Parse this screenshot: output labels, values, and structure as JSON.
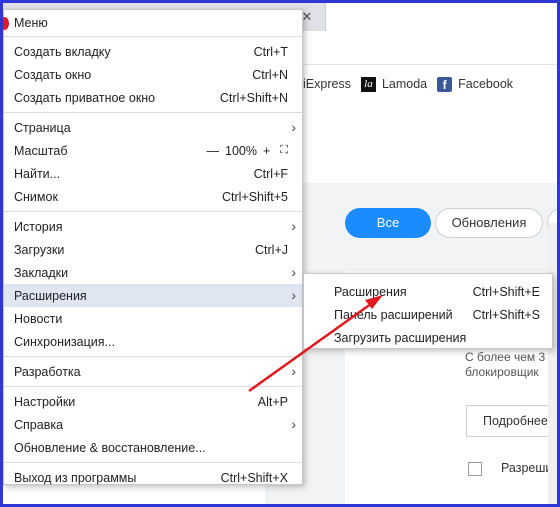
{
  "bookmarks": [
    {
      "label": "iExpress",
      "icon": "none"
    },
    {
      "label": "Lamoda",
      "icon": "la-icon"
    },
    {
      "label": "Facebook",
      "icon": "facebook-icon"
    }
  ],
  "page": {
    "filter_all": "Все",
    "filter_updates": "Обновления",
    "desc_line1": "С более чем 3",
    "desc_line2": "блокировщик",
    "more_button": "Подробнее",
    "checkbox_label": "Разреши"
  },
  "menu": {
    "title": "Меню",
    "items": [
      {
        "label": "Создать вкладку",
        "shortcut": "Ctrl+T"
      },
      {
        "label": "Создать окно",
        "shortcut": "Ctrl+N"
      },
      {
        "label": "Создать приватное окно",
        "shortcut": "Ctrl+Shift+N"
      },
      {
        "label": "Страница",
        "shortcut": ""
      },
      {
        "label": "Масштаб",
        "shortcut": ""
      },
      {
        "label": "Найти...",
        "shortcut": "Ctrl+F"
      },
      {
        "label": "Снимок",
        "shortcut": "Ctrl+Shift+5"
      },
      {
        "label": "История",
        "shortcut": ""
      },
      {
        "label": "Загрузки",
        "shortcut": "Ctrl+J"
      },
      {
        "label": "Закладки",
        "shortcut": ""
      },
      {
        "label": "Расширения",
        "shortcut": ""
      },
      {
        "label": "Новости",
        "shortcut": ""
      },
      {
        "label": "Синхронизация...",
        "shortcut": ""
      },
      {
        "label": "Разработка",
        "shortcut": ""
      },
      {
        "label": "Настройки",
        "shortcut": "Alt+P"
      },
      {
        "label": "Справка",
        "shortcut": ""
      },
      {
        "label": "Обновление & восстановление...",
        "shortcut": ""
      },
      {
        "label": "Выход из программы",
        "shortcut": "Ctrl+Shift+X"
      }
    ],
    "zoom": {
      "minus": "—",
      "value": "100%",
      "plus": "+",
      "fullscreen": "⛶"
    }
  },
  "submenu": {
    "items": [
      {
        "label": "Расширения",
        "shortcut": "Ctrl+Shift+E"
      },
      {
        "label": "Панель расширений",
        "shortcut": "Ctrl+Shift+S"
      },
      {
        "label": "Загрузить расширения",
        "shortcut": ""
      }
    ]
  },
  "colors": {
    "frame": "#2f38d4",
    "accent": "#1a8cff",
    "arrow": "#e0191e",
    "highlight": "#dfe6f2"
  }
}
